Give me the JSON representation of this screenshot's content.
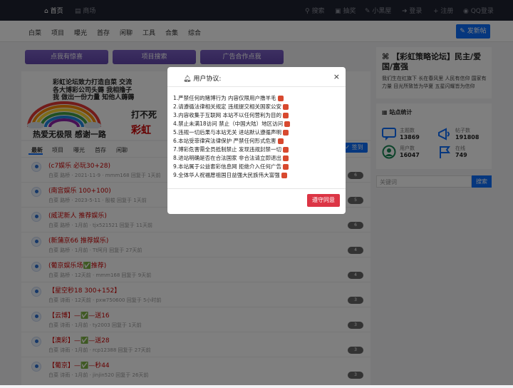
{
  "topnav": {
    "home": "首页",
    "mall": "商场",
    "search": "搜索",
    "lottery": "抽奖",
    "blackroom": "小黑屋",
    "login": "登录",
    "register": "注册",
    "qq_login": "QQ登录"
  },
  "categories": [
    "白菜",
    "项目",
    "曝光",
    "首存",
    "闲聊",
    "工具",
    "合集",
    "综合"
  ],
  "post_button": "发新帖",
  "promo_buttons": [
    "点我有惊喜",
    "项目搜索",
    "广告合作点我"
  ],
  "banner": {
    "line1": "彩虹论坛致力打造自菜 交流",
    "line2": "各大博彩公司头薅 我相撸子",
    "line3": "我 做出一份力量 知他人薅薅",
    "line4": "打不死",
    "line5": "彩虹",
    "line6": "热爱无极限    感谢一路"
  },
  "feed": {
    "tabs": [
      "最新",
      "项目",
      "曝光",
      "首存",
      "闲聊"
    ],
    "signin": "签到",
    "posts": [
      {
        "title": "(c7娱乐 必玩30+28)",
        "meta": "白菜  路桥  ·  2021-11-9  ·  mmm168  回复于 1天前",
        "count": "6"
      },
      {
        "title": "(南宫娱乐 100+100)",
        "meta": "白菜  路桥  ·  2023-5-11  ·  殷梭  回复于 1天前",
        "count": "5"
      },
      {
        "title": "(威泥新人 推荐娱乐)",
        "meta": "白菜  路桥  ·  1月前  ·  tjx521521  回复于 11天前",
        "count": "6"
      },
      {
        "title": "(新蒲京66 推荐娱乐)",
        "meta": "白菜  路桥  ·  1月前  ·  Tt阿月  回复于 27天前",
        "count": "4"
      },
      {
        "title": "(葡京娱乐场✅推荐)",
        "meta": "白菜  路桥  ·  12天前  ·  mmm168  回复于 9天前",
        "count": "4"
      },
      {
        "title": "【星空秒18 300+152】",
        "meta": "白菜  诗雨  ·  12天前  ·  pxw750600  回复于 5小时前",
        "count": "3"
      },
      {
        "title": "【云博】—✅—送16",
        "meta": "白菜  诗雨  ·  1月前  ·  ty2003  回复于 1天前",
        "count": "3"
      },
      {
        "title": "【澳彩】—✅—送28",
        "meta": "白菜  诗雨  ·  1月前  ·  rcp12388  回复于 27天前",
        "count": "3"
      },
      {
        "title": "【葡京】—✅—秒44",
        "meta": "白菜  诗雨  ·  1月前  ·  jinjin520  回复于 26天前",
        "count": "3"
      }
    ]
  },
  "sidebar": {
    "title": "【彩虹策略论坛】民主/爱国/富强",
    "desc": "我们生在红旗下 长在春风里 人民有信仰 国家有力量 目光所致皆为华夏 五星闪耀皆为信仰",
    "stats_title": "站点统计",
    "stats": [
      {
        "label": "主题数",
        "value": "13869",
        "icon": "chat-icon"
      },
      {
        "label": "帖子数",
        "value": "191808",
        "icon": "megaphone-icon"
      },
      {
        "label": "用户数",
        "value": "16047",
        "icon": "user-icon"
      },
      {
        "label": "在线",
        "value": "749",
        "icon": "flag-icon"
      }
    ],
    "search_placeholder": "关键词",
    "search_button": "搜索"
  },
  "modal": {
    "title": "用户协议:",
    "close": "×",
    "rules": [
      "1.严禁任何的赌博行为 内容仅限用户撸羊毛",
      "2.请遵循法律相关规定 违规提交相关国家公安",
      "3.内容收集于互联网 本站不以任何营利为目的",
      "4.禁止未满18访问 禁止（中国大陆）地区访问",
      "5.违规一切后果与本站无关 进站默认遵循声明",
      "6.本站受菲律宾法律保护 严禁任何形式危害",
      "7.博彩危害需全员抵制禁止 发现违规封禁一切",
      "8.进站明确是否在合法国家 非合法请立即退出",
      "9.本站属于公益套彩信息网 拒绝介入任何广告",
      "9.全体华人祝福愿祖国日益强大民族伟大富强"
    ],
    "agree": "遵守同意"
  }
}
